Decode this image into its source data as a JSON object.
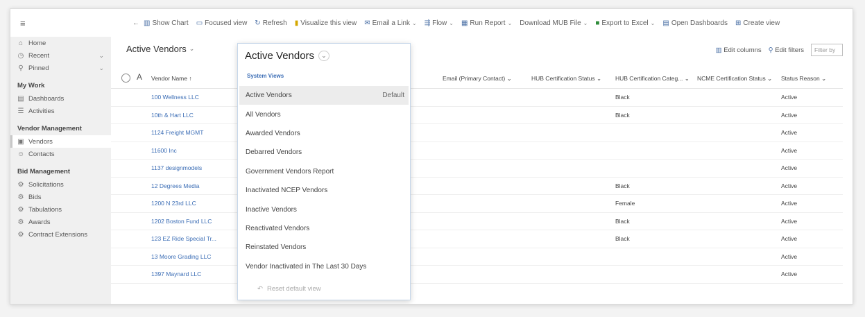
{
  "commandbar": {
    "items": [
      {
        "icon": "chart-icon",
        "label": "Show Chart",
        "caret": false,
        "color": "blue"
      },
      {
        "icon": "focused-view-icon",
        "label": "Focused view",
        "caret": false,
        "color": "blue"
      },
      {
        "icon": "refresh-icon",
        "label": "Refresh",
        "caret": false,
        "color": "blue"
      },
      {
        "icon": "visualize-icon",
        "label": "Visualize this view",
        "caret": false,
        "color": "yellow"
      },
      {
        "icon": "email-link-icon",
        "label": "Email a Link",
        "caret": true,
        "color": "blue"
      },
      {
        "icon": "flow-icon",
        "label": "Flow",
        "caret": true,
        "color": "blue"
      },
      {
        "icon": "run-report-icon",
        "label": "Run Report",
        "caret": true,
        "color": "blue"
      },
      {
        "icon": "",
        "label": "Download MUB File",
        "caret": true,
        "color": "blue"
      },
      {
        "icon": "excel-icon",
        "label": "Export to Excel",
        "caret": true,
        "color": "green"
      },
      {
        "icon": "dashboard-icon",
        "label": "Open Dashboards",
        "caret": false,
        "color": "blue"
      },
      {
        "icon": "create-view-icon",
        "label": "Create view",
        "caret": false,
        "color": "blue"
      }
    ]
  },
  "sidenav": {
    "top": [
      {
        "icon": "home-icon",
        "label": "Home",
        "chevron": false
      },
      {
        "icon": "recent-icon",
        "label": "Recent",
        "chevron": true
      },
      {
        "icon": "pin-icon",
        "label": "Pinned",
        "chevron": true
      }
    ],
    "groups": [
      {
        "title": "My Work",
        "items": [
          {
            "icon": "dashboard-icon",
            "label": "Dashboards",
            "active": false
          },
          {
            "icon": "activities-icon",
            "label": "Activities",
            "active": false
          }
        ]
      },
      {
        "title": "Vendor Management",
        "items": [
          {
            "icon": "vendors-icon",
            "label": "Vendors",
            "active": true
          },
          {
            "icon": "contacts-icon",
            "label": "Contacts",
            "active": false
          }
        ]
      },
      {
        "title": "Bid Management",
        "items": [
          {
            "icon": "solicitations-icon",
            "label": "Solicitations",
            "active": false
          },
          {
            "icon": "bids-icon",
            "label": "Bids",
            "active": false
          },
          {
            "icon": "tabulations-icon",
            "label": "Tabulations",
            "active": false
          },
          {
            "icon": "awards-icon",
            "label": "Awards",
            "active": false
          },
          {
            "icon": "contract-extensions-icon",
            "label": "Contract Extensions",
            "active": false
          }
        ]
      }
    ]
  },
  "main": {
    "view_title": "Active Vendors",
    "edit_columns": "Edit columns",
    "edit_filters": "Edit filters",
    "filter_placeholder": "Filter by"
  },
  "grid": {
    "headers": {
      "vendor_name": "Vendor Name ↑",
      "email": "Email (Primary Contact)",
      "hub_status": "HUB Certification Status",
      "hub_category": "HUB Certification Categ...",
      "ncme_status": "NCME Certification Status",
      "status_reason": "Status Reason"
    },
    "rows": [
      {
        "name": "100 Wellness LLC",
        "category": "Black",
        "status": "Active"
      },
      {
        "name": "10th & Hart LLC",
        "category": "Black",
        "status": "Active"
      },
      {
        "name": "1124 Freight MGMT",
        "category": "",
        "status": "Active"
      },
      {
        "name": "11600 Inc",
        "category": "",
        "status": "Active"
      },
      {
        "name": "1137 designmodels",
        "category": "",
        "status": "Active"
      },
      {
        "name": "12 Degrees Media",
        "category": "Black",
        "status": "Active"
      },
      {
        "name": "1200 N 23rd LLC",
        "category": "Female",
        "status": "Active"
      },
      {
        "name": "1202 Boston Fund LLC",
        "category": "Black",
        "status": "Active"
      },
      {
        "name": "123 EZ Ride Special Tr...",
        "category": "Black",
        "status": "Active"
      },
      {
        "name": "13 Moore Grading LLC",
        "category": "",
        "status": "Active"
      },
      {
        "name": "1397 Maynard LLC",
        "category": "",
        "status": "Active"
      }
    ]
  },
  "dropdown": {
    "title": "Active Vendors",
    "section": "System Views",
    "default_label": "Default",
    "items": [
      {
        "label": "Active Vendors",
        "selected": true
      },
      {
        "label": "All Vendors",
        "selected": false
      },
      {
        "label": "Awarded Vendors",
        "selected": false
      },
      {
        "label": "Debarred Vendors",
        "selected": false
      },
      {
        "label": "Government Vendors Report",
        "selected": false
      },
      {
        "label": "Inactivated NCEP Vendors",
        "selected": false
      },
      {
        "label": "Inactive Vendors",
        "selected": false
      },
      {
        "label": "Reactivated Vendors",
        "selected": false
      },
      {
        "label": "Reinstated Vendors",
        "selected": false
      },
      {
        "label": "Vendor Inactivated in The Last 30 Days",
        "selected": false
      }
    ],
    "reset_label": "Reset default view"
  },
  "icon_glyphs": {
    "hamburger-icon": "≡",
    "back-icon": "←",
    "chart-icon": "▥",
    "focused-view-icon": "▭",
    "refresh-icon": "↻",
    "visualize-icon": "▮",
    "email-link-icon": "✉",
    "flow-icon": "⇶",
    "run-report-icon": "▦",
    "excel-icon": "■",
    "dashboard-icon": "▤",
    "create-view-icon": "⊞",
    "home-icon": "⌂",
    "recent-icon": "◷",
    "pin-icon": "⚲",
    "activities-icon": "☰",
    "vendors-icon": "▣",
    "contacts-icon": "☺",
    "solicitations-icon": "⚙",
    "bids-icon": "⚙",
    "tabulations-icon": "⚙",
    "awards-icon": "⚙",
    "contract-extensions-icon": "⚙",
    "edit-columns-icon": "▥",
    "edit-filters-icon": "⚲",
    "reset-icon": "↶"
  }
}
